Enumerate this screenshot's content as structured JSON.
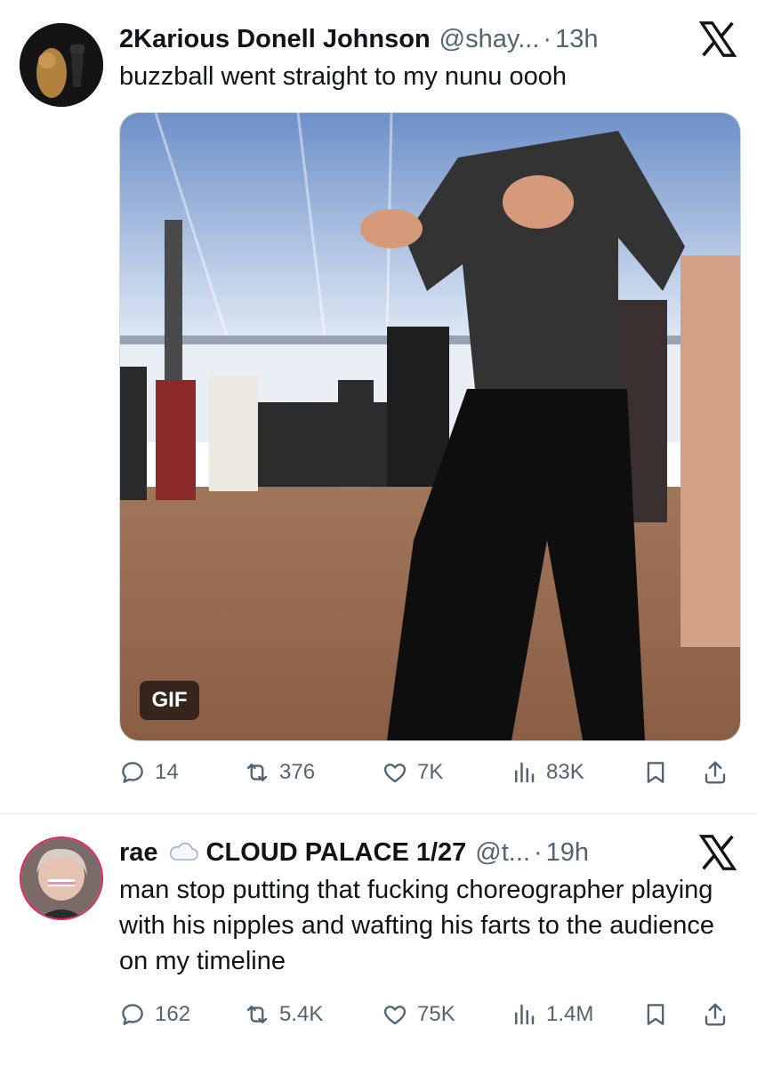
{
  "tweets": [
    {
      "name": "2Karious Donell Johnson",
      "handle": "@shay...",
      "separator": "·",
      "time": "13h",
      "text": "buzzball went straight to my nunu oooh",
      "media_badge": "GIF",
      "replies": "14",
      "reposts": "376",
      "likes": "7K",
      "views": "83K"
    },
    {
      "name": "rae",
      "name_extra": "CLOUD PALACE 1/27",
      "handle": "@t...",
      "separator": "·",
      "time": "19h",
      "text": "man stop putting that fucking choreographer playing with his nipples and wafting his farts to the audience on my timeline",
      "replies": "162",
      "reposts": "5.4K",
      "likes": "75K",
      "views": "1.4M"
    }
  ],
  "icons": {
    "close": "x-logo-icon",
    "reply": "reply-icon",
    "repost": "repost-icon",
    "like": "like-icon",
    "views": "views-icon",
    "bookmark": "bookmark-icon",
    "share": "share-icon",
    "cloud": "cloud-icon"
  },
  "colors": {
    "text": "#0f1419",
    "secondary": "#536471",
    "divider": "#e6ecf0"
  }
}
